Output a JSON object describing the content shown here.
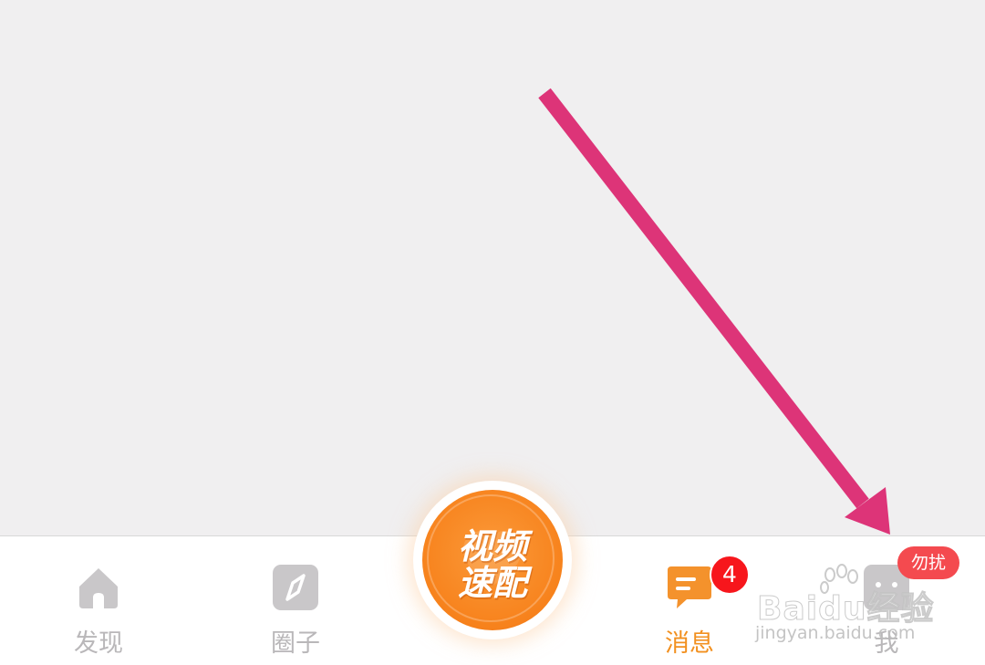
{
  "tabs": [
    {
      "label": "发现",
      "icon": "home-icon",
      "active": false
    },
    {
      "label": "圈子",
      "icon": "compass-icon",
      "active": false
    },
    {
      "label": "视频速配",
      "line1": "视频",
      "line2": "速配",
      "icon": "video-match-button"
    },
    {
      "label": "消息",
      "icon": "message-icon",
      "active": true,
      "badge": "4"
    },
    {
      "label": "我",
      "icon": "profile-icon",
      "active": false,
      "badge": "勿扰"
    }
  ],
  "watermark": {
    "main": "Baidu经验",
    "sub": "jingyan.baidu.com"
  },
  "colors": {
    "background": "#f0eff0",
    "active": "#f2901f",
    "inactive": "#b9b7b9",
    "badge": "#f7161c",
    "dnd_badge": "#f44a4f",
    "arrow": "#dd3478"
  }
}
